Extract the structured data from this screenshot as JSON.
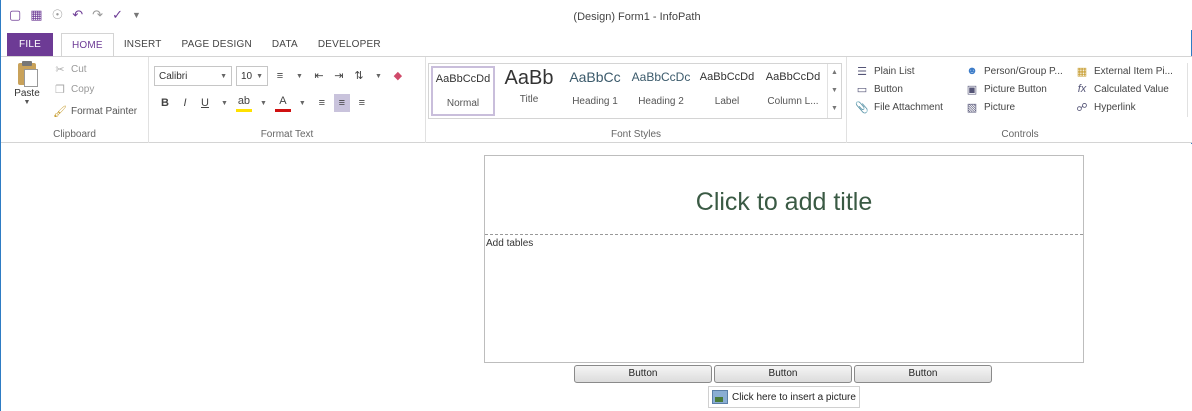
{
  "window": {
    "title": "(Design) Form1 - InfoPath"
  },
  "qat": {
    "app_icon": "infopath-logo-icon",
    "save_icon": "save-icon",
    "preview_icon": "preview-icon",
    "undo_icon": "undo-icon",
    "redo_icon": "redo-icon",
    "spelling_icon": "spelling-icon",
    "customize_icon": "customize-qat-icon"
  },
  "tabs": {
    "file": "FILE",
    "home": "HOME",
    "insert": "INSERT",
    "page_design": "PAGE DESIGN",
    "data": "DATA",
    "developer": "DEVELOPER"
  },
  "clipboard": {
    "paste": "Paste",
    "cut": "Cut",
    "copy": "Copy",
    "format_painter": "Format Painter",
    "label": "Clipboard"
  },
  "format_text": {
    "font_name": "Calibri",
    "font_size": "10",
    "bold": "B",
    "italic": "I",
    "underline": "U",
    "label": "Format Text"
  },
  "font_styles": {
    "label": "Font Styles",
    "items": [
      {
        "sample": "AaBbCcDd",
        "name": "Normal"
      },
      {
        "sample": "AaBb",
        "name": "Title"
      },
      {
        "sample": "AaBbCc",
        "name": "Heading 1"
      },
      {
        "sample": "AaBbCcDc",
        "name": "Heading 2"
      },
      {
        "sample": "AaBbCcDd",
        "name": "Label"
      },
      {
        "sample": "AaBbCcDd",
        "name": "Column L..."
      }
    ]
  },
  "controls": {
    "label": "Controls",
    "plain_list": "Plain List",
    "button": "Button",
    "file_attachment": "File Attachment",
    "person_group": "Person/Group P...",
    "picture_button": "Picture Button",
    "picture": "Picture",
    "external_item": "External Item Pi...",
    "calculated_value": "Calculated Value",
    "hyperlink": "Hyperlink"
  },
  "form": {
    "title_placeholder": "Click to add title",
    "tables_placeholder": "Add tables",
    "buttons": [
      "Button",
      "Button",
      "Button"
    ],
    "picture_placeholder": "Click here to insert a picture"
  },
  "colors": {
    "file_tab": "#6d3b95",
    "accent_border": "#2e7cc4",
    "title_text": "#3a5a44"
  }
}
